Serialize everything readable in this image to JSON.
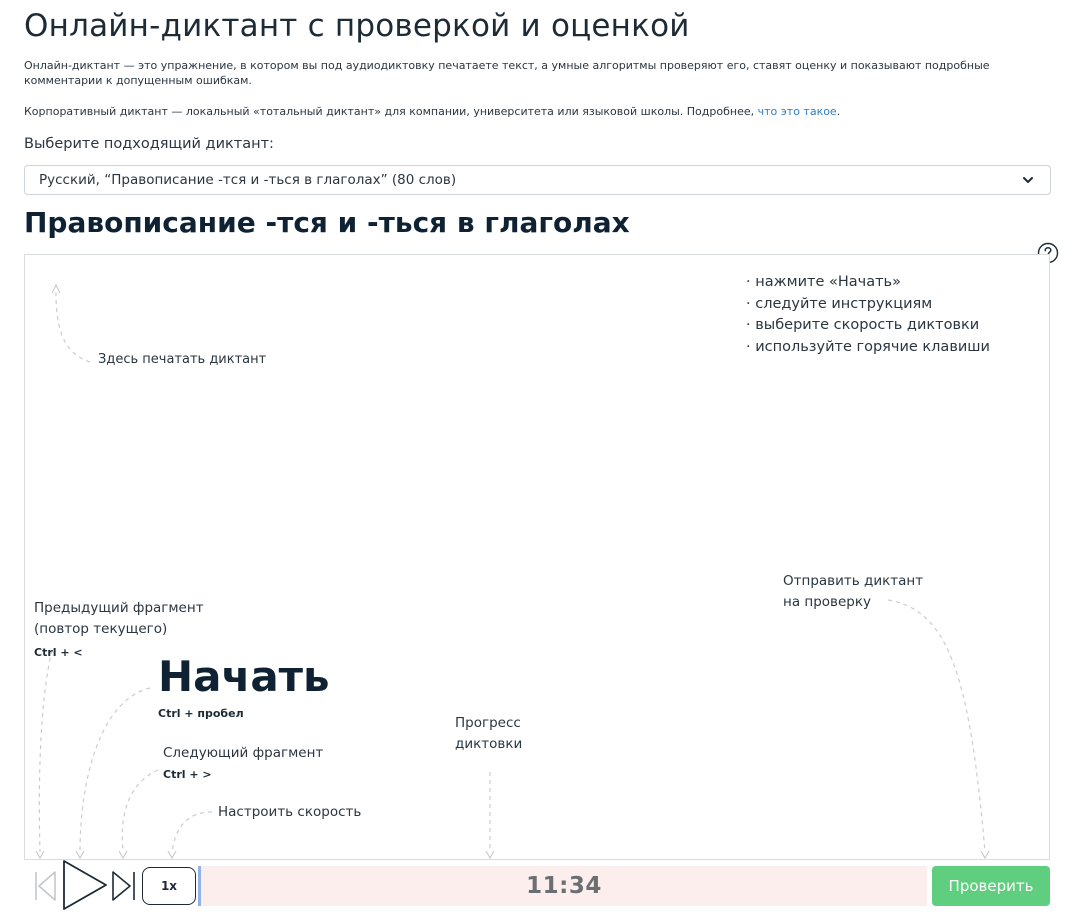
{
  "page": {
    "title": "Онлайн-диктант с проверкой и оценкой",
    "intro": "Онлайн-диктант — это упражнение, в котором вы под аудиодиктовку печатаете текст, а умные алгоритмы проверяют его, ставят оценку и показывают подробные комментарии к допущенным ошибкам.",
    "corp_text": "Корпоративный диктант — локальный «тотальный диктант» для компании, университета или языковой школы. Подробнее, ",
    "corp_link": "что это такое",
    "corp_end": "."
  },
  "selector": {
    "label": "Выберите подходящий диктант:",
    "selected": "Русский, “Правописание -тся и -ться в глаголах” (80 слов)"
  },
  "dictation": {
    "title": "Правописание -тся и -ться в глаголах"
  },
  "editor": {
    "type_hint": "Здесь печатать диктант",
    "instructions": [
      "нажмите «Начать»",
      "следуйте инструкциям",
      "выберите скорость диктовки",
      "используйте горячие клавиши"
    ],
    "prev_hint_line1": "Предыдущий фрагмент",
    "prev_hint_line2": "(повтор текущего)",
    "prev_key": "Ctrl + <",
    "start_label": "Начать",
    "start_key": "Ctrl + пробел",
    "next_hint": "Следующий фрагмент",
    "next_key": "Ctrl + >",
    "speed_hint": "Настроить скорость",
    "progress_hint_line1": "Прогресс",
    "progress_hint_line2": "диктовки",
    "send_hint_line1": "Отправить диктант",
    "send_hint_line2": "на проверку"
  },
  "controls": {
    "speed": "1x",
    "timer": "11:34",
    "check_label": "Проверить"
  },
  "colors": {
    "check_button": "#5fcf7f",
    "progress_bg": "#fdeeee",
    "link": "#2f7cc4"
  }
}
